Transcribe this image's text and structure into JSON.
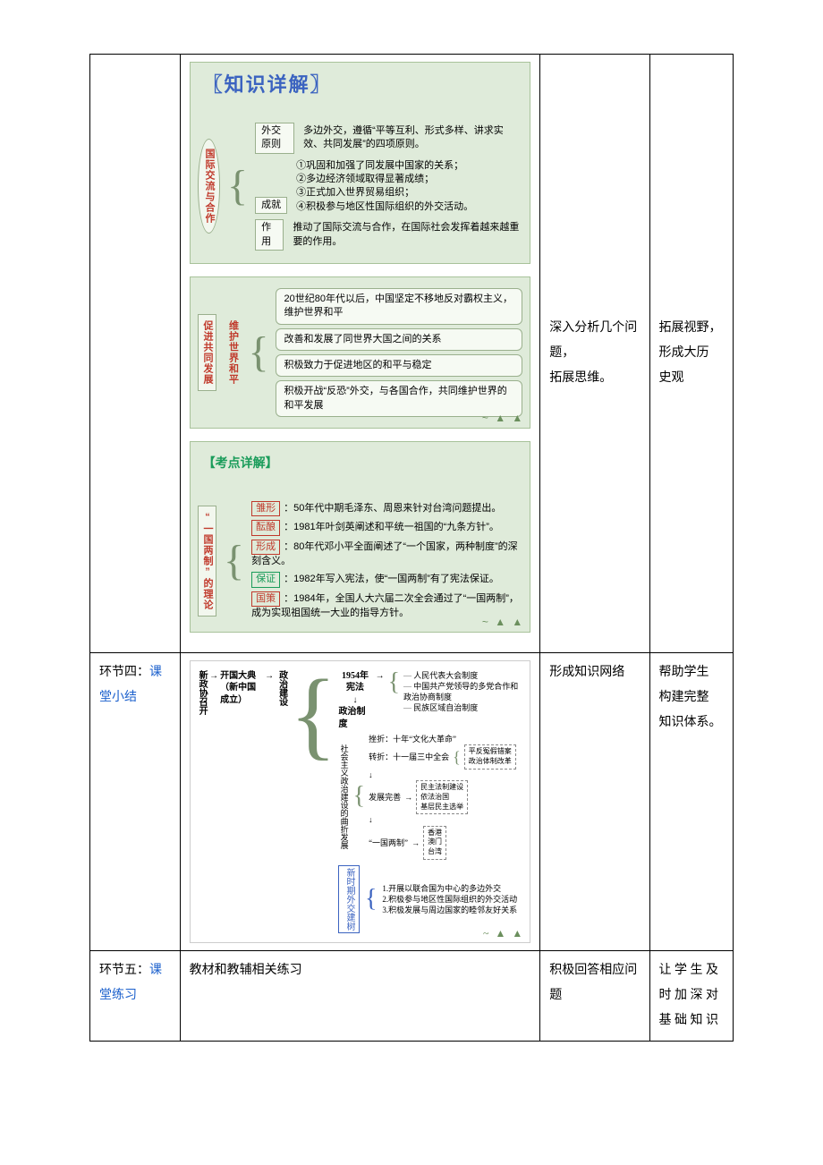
{
  "row1": {
    "col3_l1": "深入分析几个问题，",
    "col3_l2": "拓展思维。",
    "col4_l1": "拓展视野，",
    "col4_l2": "形成大历",
    "col4_l3": "史观"
  },
  "row2": {
    "col1_l1_a": "环节四：",
    "col1_l1_b": "课",
    "col1_l2": "堂小结",
    "col3": "形成知识网络",
    "col4_l1": "帮助学生",
    "col4_l2": "构建完整",
    "col4_l3": "知识体系。"
  },
  "row3": {
    "col1_l1_a": "环节五：",
    "col1_l1_b": "课",
    "col1_l2": "堂练习",
    "col2": "教材和教辅相关练习",
    "col3": "积极回答相应问题",
    "col4_l1": "让 学 生 及",
    "col4_l2": "时 加 深 对",
    "col4_l3": "基 础 知 识"
  },
  "slide1": {
    "title": "〖知识详解〗",
    "bubble": "国际交流与合作",
    "principle_tag": "外交原则",
    "principle_text": "多边外交，遵循“平等互利、形式多样、讲求实效、共同发展”的四项原则。",
    "achievement_tag": "成就",
    "a1": "①巩固和加强了同发展中国家的关系；",
    "a2": "②多边经济领域取得显著成绩；",
    "a3": "③正式加入世界贸易组织；",
    "a4": "④积极参与地区性国际组织的外交活动。",
    "role_tag": "作用",
    "role_text": "推动了国际交流与合作，在国际社会发挥着越来越重要的作用。"
  },
  "slide2": {
    "vlabel_left": "促进共同发展",
    "vlabel_right": "维护世界和平",
    "p1": "20世纪80年代以后，中国坚定不移地反对霸权主义，维护世界和平",
    "p2": "改善和发展了同世界大国之间的关系",
    "p3": "积极致力于促进地区的和平与稳定",
    "p4": "积极开战“反恐”外交，与各国合作，共同维护世界的和平发展"
  },
  "slide3": {
    "title": "【考点详解】",
    "vlabel": "“一国两制”的理论",
    "l1_lbl": "雏形",
    "l1_txt": "：50年代中期毛泽东、周恩来针对台湾问题提出。",
    "l2_lbl": "酝酿",
    "l2_txt": "：1981年叶剑英阐述和平统一祖国的“九条方针”。",
    "l3_lbl": "形成",
    "l3_txt": "：80年代邓小平全面阐述了“一个国家，两种制度”的深刻含义。",
    "l4_lbl": "保证",
    "l4_txt": "：1982年写入宪法，使“一国两制”有了宪法保证。",
    "l5_lbl": "国策",
    "l5_txt": "：1984年，全国人大六届二次全会通过了“一国两制”，成为实现祖国统一大业的指导方针。"
  },
  "slide4": {
    "root1": "新政协召开",
    "root2": "开国大典（新中国成立）",
    "root3": "政治建设",
    "const": "1954年宪法",
    "sys_label": "政治制度",
    "sys1": "人民代表大会制度",
    "sys2": "中国共产党领导的多党合作和政治协商制度",
    "sys3": "民族区域自治制度",
    "branch_label": "社会主义政治建设的曲折发展",
    "setback1": "挫折：十年“文化大革命”",
    "turn": "转折：十一届三中全会",
    "turn_r1": "平反冤假错案",
    "turn_r2": "政治体制改革",
    "dev_label": "发展完善",
    "dev1": "民主法制建设",
    "dev2": "依法治国",
    "dev3": "基层民主选举",
    "one_two": "“一国两制”",
    "ot1": "香港",
    "ot2": "澳门",
    "ot3": "台湾",
    "dip_box": "新时期外交建树",
    "dip1": "1.开展以联合国为中心的多边外交",
    "dip2": "2.积极参与地区性国际组织的外交活动",
    "dip3": "3.积极发展与周边国家的睦邻友好关系"
  },
  "footer_marks": "~ ▲ ▲"
}
